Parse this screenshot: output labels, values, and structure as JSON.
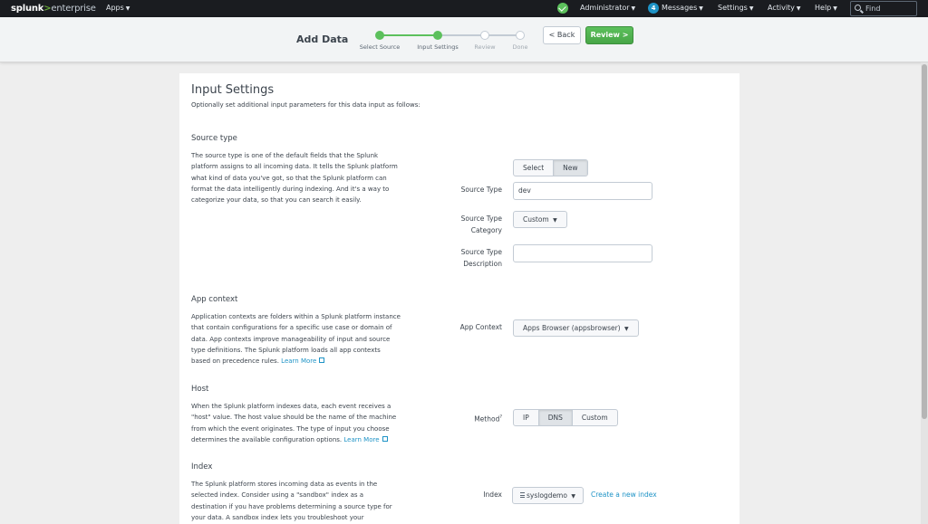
{
  "topbar": {
    "logo_brand": "splunk",
    "logo_gt": ">",
    "logo_product": "enterprise",
    "apps": "Apps",
    "user": "Administrator",
    "messages_count": "4",
    "messages": "Messages",
    "settings": "Settings",
    "activity": "Activity",
    "help": "Help",
    "find": "Find",
    "status_color": "#5cc05c"
  },
  "wizard": {
    "title": "Add Data",
    "steps": [
      {
        "label": "Select Source",
        "state": "done"
      },
      {
        "label": "Input Settings",
        "state": "done"
      },
      {
        "label": "Review",
        "state": "todo"
      },
      {
        "label": "Done",
        "state": "todo"
      }
    ],
    "back_label": "< Back",
    "review_label": "Review >"
  },
  "page": {
    "title": "Input Settings",
    "intro": "Optionally set additional input parameters for this data input as follows:"
  },
  "source_type": {
    "title": "Source type",
    "desc_lines": [
      "The source type is one of the default fields that the Splunk",
      "platform assigns to all incoming data. It tells the Splunk platform",
      "what kind of data you've got, so that the Splunk platform can",
      "format the data intelligently during indexing. And it's a way to",
      "categorize your data, so that you can search it easily."
    ],
    "toggle": [
      "Select",
      "New"
    ],
    "toggle_active": "New",
    "source_type_label": "Source Type",
    "source_type_value": "dev",
    "category_label_1": "Source Type",
    "category_label_2": "Category",
    "category_value": "Custom",
    "description_label_1": "Source Type",
    "description_label_2": "Description",
    "description_value": ""
  },
  "app_context": {
    "title": "App context",
    "desc_lines": [
      "Application contexts are folders within a Splunk platform instance",
      "that contain configurations for a specific use case or domain of",
      "data. App contexts improve manageability of input and source",
      "type definitions. The Splunk platform loads all app contexts"
    ],
    "desc_last": "based on precedence rules.",
    "learn_more": "Learn More",
    "label": "App Context",
    "value": "Apps Browser (appsbrowser)"
  },
  "host": {
    "title": "Host",
    "desc_lines": [
      "When the Splunk platform indexes data, each event receives a",
      "\"host\" value. The host value should be the name of the machine",
      "from which the event originates. The type of input you choose"
    ],
    "desc_last": "determines the available configuration options.",
    "learn_more": "Learn More",
    "method_label": "Method",
    "method_help": "?",
    "methods": [
      "IP",
      "DNS",
      "Custom"
    ],
    "method_active": "DNS"
  },
  "index": {
    "title": "Index",
    "desc_lines": [
      "The Splunk platform stores incoming data as events in the",
      "selected index. Consider using a \"sandbox\" index as a",
      "destination if you have problems determining a source type for",
      "your data. A sandbox index lets you troubleshoot your"
    ],
    "label": "Index",
    "value": "syslogdemo",
    "create_link": "Create a new index"
  }
}
